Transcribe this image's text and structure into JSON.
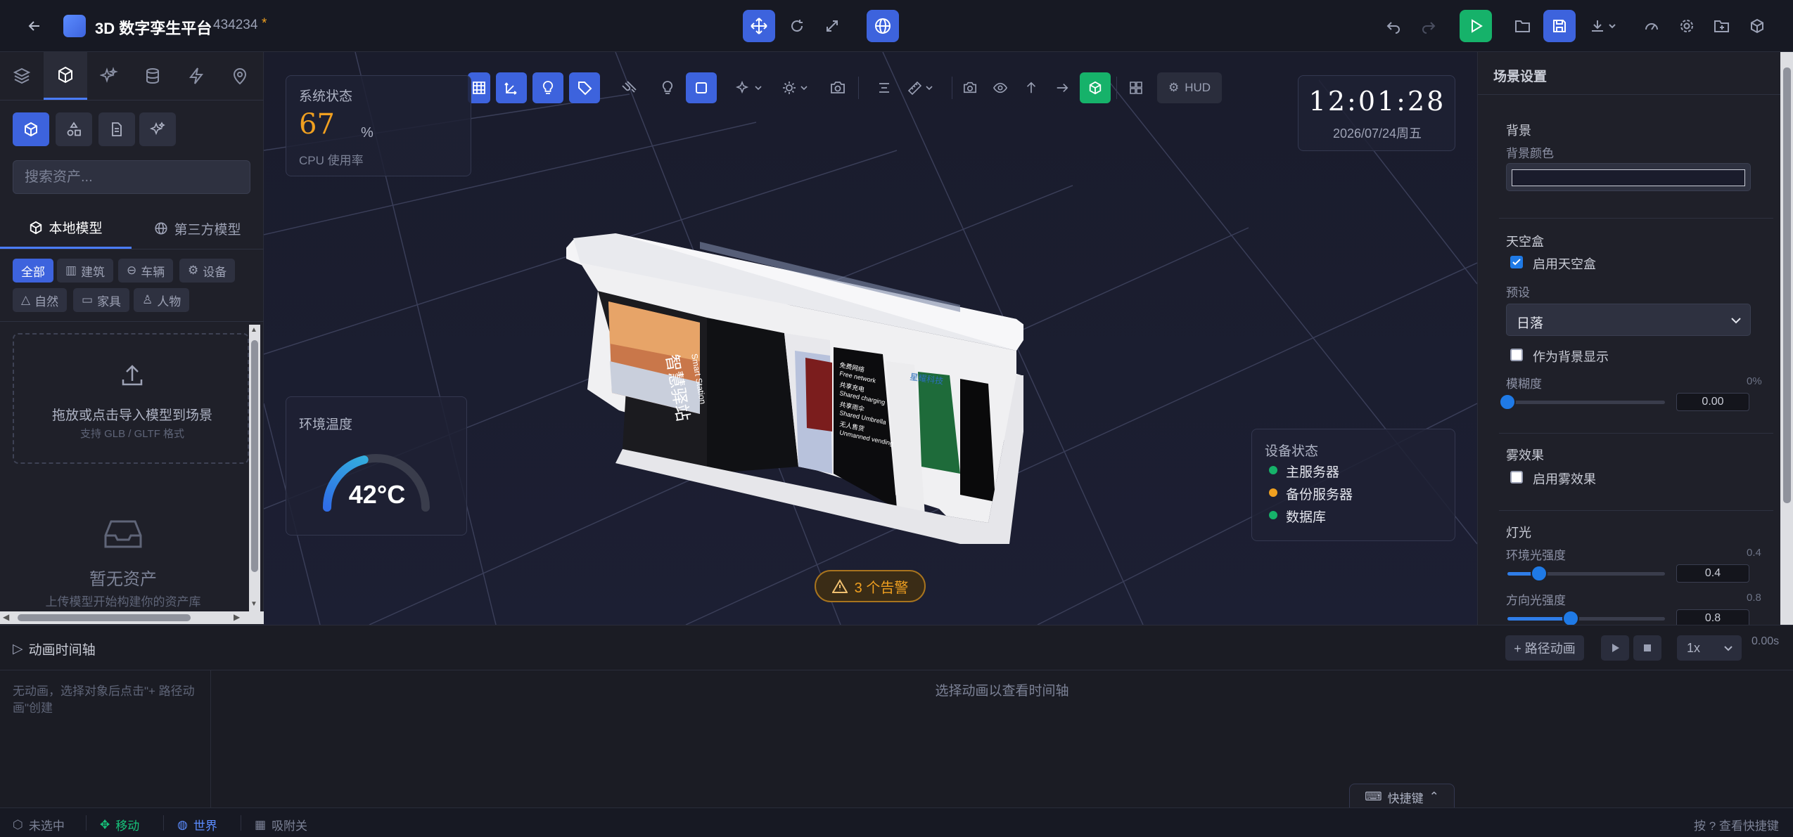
{
  "header": {
    "title": "3D 数字孪生平台",
    "project_id": "434234",
    "unsaved_mark": "*"
  },
  "left": {
    "search_placeholder": "搜索资产...",
    "model_tabs": [
      "本地模型",
      "第三方模型"
    ],
    "categories": [
      "全部",
      "建筑",
      "车辆",
      "设备",
      "自然",
      "家具",
      "人物"
    ],
    "upload_title": "拖放或点击导入模型到场景",
    "upload_hint": "支持 GLB / GLTF 格式",
    "empty_title": "暂无资产",
    "empty_hint": "上传模型开始构建你的资产库"
  },
  "viewport": {
    "hud_label": "HUD",
    "system_status": {
      "title": "系统状态",
      "value": "67",
      "unit": "%",
      "caption": "CPU 使用率"
    },
    "clock": {
      "time": "12:01:28",
      "date": "2026/07/24周五"
    },
    "temperature": {
      "title": "环境温度",
      "value": "42°C",
      "fraction": 0.42
    },
    "devices": {
      "title": "设备状态",
      "items": [
        {
          "label": "主服务器",
          "color": "#16b26a"
        },
        {
          "label": "备份服务器",
          "color": "#f0a020"
        },
        {
          "label": "数据库",
          "color": "#16b26a"
        }
      ]
    },
    "alert": "3 个告警",
    "model_text": {
      "brand_cn": "智慧驿站",
      "brand_en": "Smart Station",
      "company": "星耀科技",
      "services": [
        "免费网络",
        "Free network",
        "共享充电",
        "Shared charging",
        "共享雨伞",
        "Shared Umbrella",
        "无人售货",
        "Unmanned vending"
      ]
    }
  },
  "right": {
    "title": "场景设置",
    "background": {
      "section": "背景",
      "color_label": "背景颜色"
    },
    "skybox": {
      "section": "天空盒",
      "enable_label": "启用天空盒",
      "enabled": true,
      "preset_label": "预设",
      "preset_value": "日落",
      "as_bg_label": "作为背景显示",
      "blur_label": "模糊度",
      "blur_percent": "0%",
      "blur_value": "0.00",
      "blur_fraction": 0.0
    },
    "fog": {
      "section": "雾效果",
      "enable_label": "启用雾效果"
    },
    "lights": {
      "section": "灯光",
      "ambient_label": "环境光强度",
      "ambient_value": "0.4",
      "ambient_fraction": 0.2,
      "dir_label": "方向光强度",
      "dir_value": "0.8",
      "dir_fraction": 0.4
    }
  },
  "timeline": {
    "title": "动画时间轴",
    "path_anim": "+ 路径动画",
    "speed": "1x",
    "time": "0.00s",
    "empty_left": "无动画，选择对象后点击\"+ 路径动画\"创建",
    "empty_center": "选择动画以查看时间轴",
    "shortcuts": "快捷键"
  },
  "status": {
    "selection": "未选中",
    "mode": "移动",
    "space": "世界",
    "snap": "吸附关",
    "hint": "按 ? 查看快捷键"
  }
}
